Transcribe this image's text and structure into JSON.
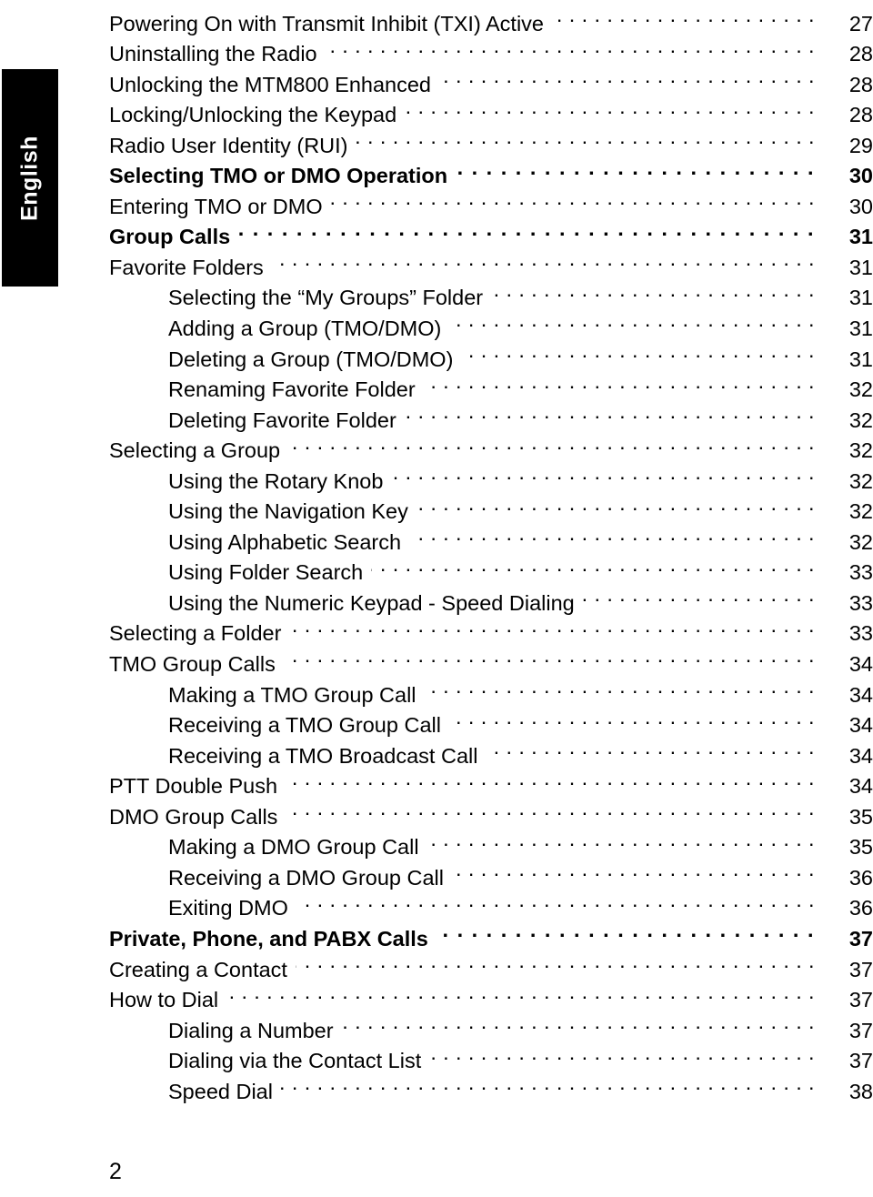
{
  "sidebar": {
    "language_tab_label": "English"
  },
  "footer": {
    "page_number": "2"
  },
  "toc": {
    "entries": [
      {
        "title": "Powering On with Transmit Inhibit (TXI) Active",
        "page": "27",
        "level": 1,
        "bold": false
      },
      {
        "title": "Uninstalling the Radio",
        "page": "28",
        "level": 1,
        "bold": false
      },
      {
        "title": "Unlocking the MTM800 Enhanced",
        "page": "28",
        "level": 1,
        "bold": false
      },
      {
        "title": "Locking/Unlocking the Keypad",
        "page": "28",
        "level": 1,
        "bold": false
      },
      {
        "title": "Radio User Identity (RUI)",
        "page": "29",
        "level": 1,
        "bold": false
      },
      {
        "title": "Selecting TMO or DMO Operation",
        "page": "30",
        "level": 1,
        "bold": true
      },
      {
        "title": "Entering TMO or DMO",
        "page": "30",
        "level": 1,
        "bold": false
      },
      {
        "title": "Group Calls",
        "page": "31",
        "level": 1,
        "bold": true
      },
      {
        "title": "Favorite Folders",
        "page": "31",
        "level": 1,
        "bold": false
      },
      {
        "title": "Selecting the “My Groups” Folder",
        "page": "31",
        "level": 2,
        "bold": false
      },
      {
        "title": "Adding a Group (TMO/DMO)",
        "page": "31",
        "level": 2,
        "bold": false
      },
      {
        "title": "Deleting a Group (TMO/DMO)",
        "page": "31",
        "level": 2,
        "bold": false
      },
      {
        "title": "Renaming Favorite Folder",
        "page": "32",
        "level": 2,
        "bold": false
      },
      {
        "title": "Deleting Favorite Folder",
        "page": "32",
        "level": 2,
        "bold": false
      },
      {
        "title": "Selecting a Group",
        "page": "32",
        "level": 1,
        "bold": false
      },
      {
        "title": "Using the Rotary Knob",
        "page": "32",
        "level": 2,
        "bold": false
      },
      {
        "title": "Using the Navigation Key",
        "page": "32",
        "level": 2,
        "bold": false
      },
      {
        "title": "Using Alphabetic Search",
        "page": "32",
        "level": 2,
        "bold": false
      },
      {
        "title": "Using Folder Search",
        "page": "33",
        "level": 2,
        "bold": false
      },
      {
        "title": "Using the Numeric Keypad - Speed Dialing",
        "page": "33",
        "level": 2,
        "bold": false
      },
      {
        "title": "Selecting a Folder",
        "page": "33",
        "level": 1,
        "bold": false
      },
      {
        "title": "TMO Group Calls",
        "page": "34",
        "level": 1,
        "bold": false
      },
      {
        "title": "Making a TMO Group Call",
        "page": "34",
        "level": 2,
        "bold": false
      },
      {
        "title": "Receiving a TMO Group Call",
        "page": "34",
        "level": 2,
        "bold": false
      },
      {
        "title": "Receiving a TMO Broadcast Call",
        "page": "34",
        "level": 2,
        "bold": false
      },
      {
        "title": "PTT Double Push",
        "page": "34",
        "level": 1,
        "bold": false
      },
      {
        "title": "DMO Group Calls",
        "page": "35",
        "level": 1,
        "bold": false
      },
      {
        "title": "Making a DMO Group Call",
        "page": "35",
        "level": 2,
        "bold": false
      },
      {
        "title": "Receiving a DMO Group Call",
        "page": "36",
        "level": 2,
        "bold": false
      },
      {
        "title": "Exiting DMO",
        "page": "36",
        "level": 2,
        "bold": false
      },
      {
        "title": "Private, Phone, and PABX Calls",
        "page": "37",
        "level": 1,
        "bold": true
      },
      {
        "title": "Creating a Contact",
        "page": "37",
        "level": 1,
        "bold": false
      },
      {
        "title": "How to Dial",
        "page": "37",
        "level": 1,
        "bold": false
      },
      {
        "title": "Dialing a Number",
        "page": "37",
        "level": 2,
        "bold": false
      },
      {
        "title": "Dialing via the Contact List",
        "page": "37",
        "level": 2,
        "bold": false
      },
      {
        "title": "Speed Dial",
        "page": "38",
        "level": 2,
        "bold": false
      }
    ]
  }
}
